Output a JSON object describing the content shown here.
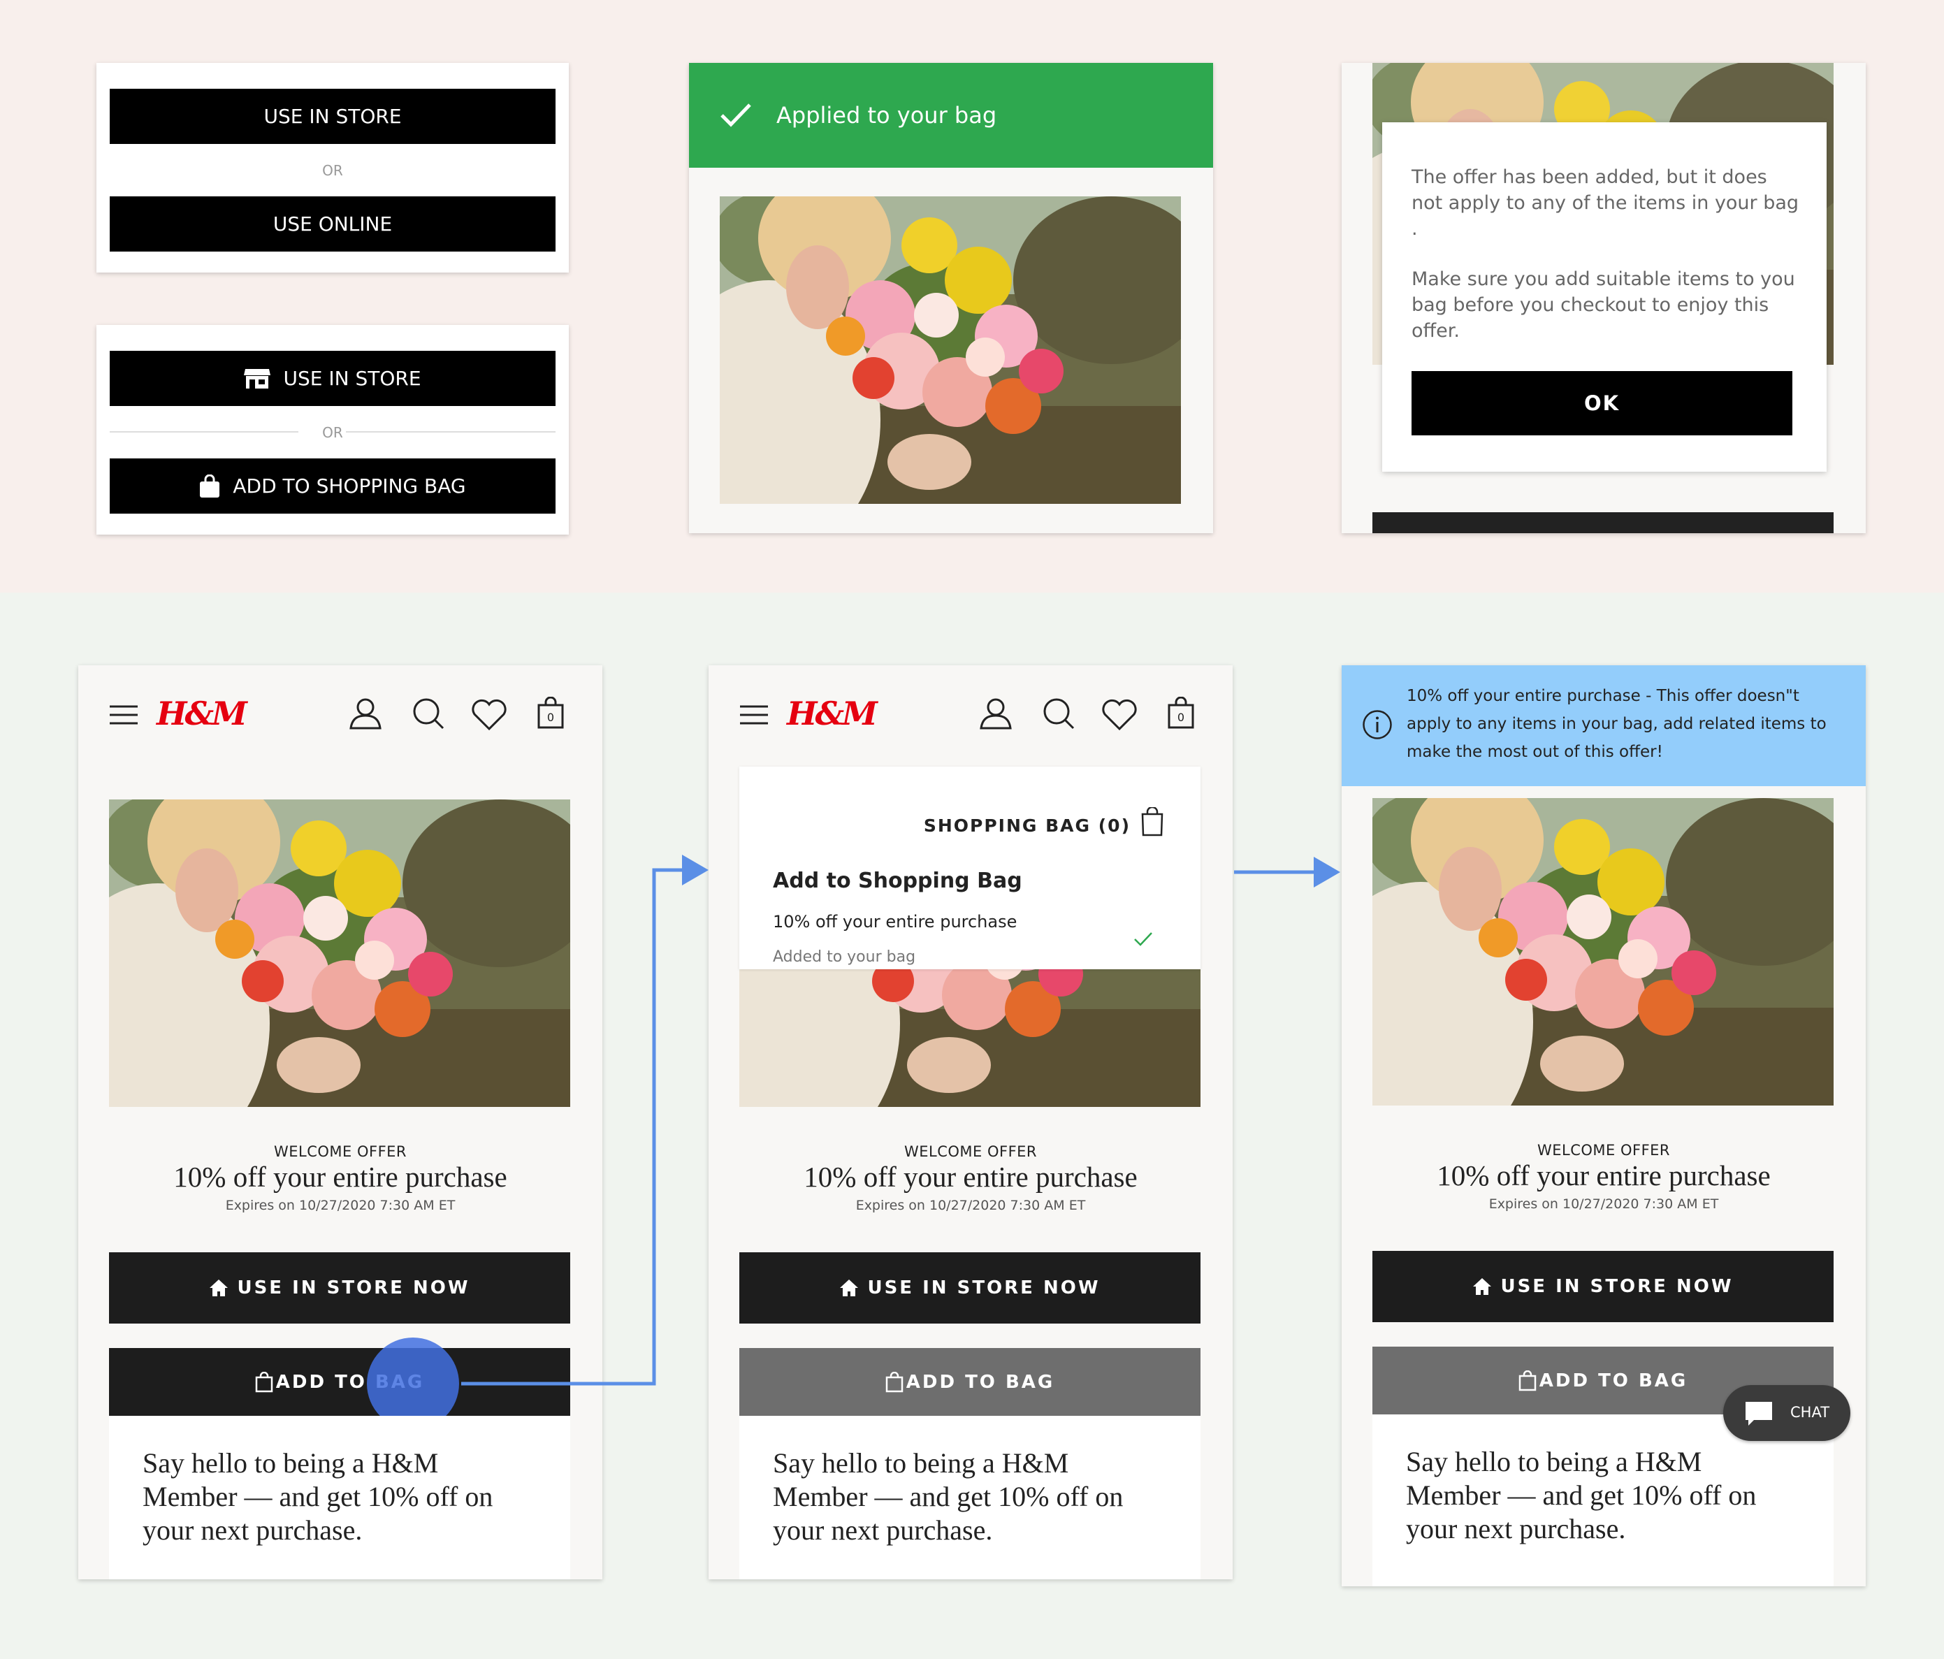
{
  "colors": {
    "success_green": "#2ea84f",
    "info_blue": "#93cdfb",
    "brand_red": "#e50010",
    "connector_blue": "#5b8fe6",
    "tap_highlight": "#4d7be0"
  },
  "card_a": {
    "use_in_store": "USE IN STORE",
    "or": "OR",
    "use_online": "USE ONLINE"
  },
  "card_b": {
    "use_in_store": "USE IN STORE",
    "or": "OR",
    "add_to_bag": "ADD TO SHOPPING BAG",
    "store_icon": "store-icon",
    "bag_icon": "bag-icon"
  },
  "toast": {
    "message": "Applied to your bag",
    "icon": "checkmark-icon"
  },
  "dialog": {
    "line1": "The offer has been added, but it does not apply to any of the items in your bag .",
    "line2": "Make sure you add suitable items to you bag before you checkout to enjoy this offer.",
    "ok": "OK"
  },
  "brand_logo": "H&M",
  "nav_icons": [
    "menu-icon",
    "account-icon",
    "search-icon",
    "heart-icon",
    "shopping-bag-icon"
  ],
  "bag_count": "0",
  "offer": {
    "heading": "WELCOME OFFER",
    "title": "10% off your entire purchase",
    "expires": "Expires on 10/27/2020 7:30 AM ET",
    "use_in_store_now": "USE IN STORE NOW",
    "add_to_bag": "ADD TO BAG",
    "promo": "Say hello to being a H&M Member — and get 10% off on your next purchase."
  },
  "bag_panel": {
    "title": "SHOPPING BAG (0)",
    "heading": "Add to Shopping Bag",
    "item": "10% off your entire purchase",
    "status": "Added to your bag"
  },
  "info_banner": "10% off your entire purchase - This offer doesn\"t apply to any items in your bag, add related items to make the most out of this offer!",
  "chat_label": "CHAT"
}
